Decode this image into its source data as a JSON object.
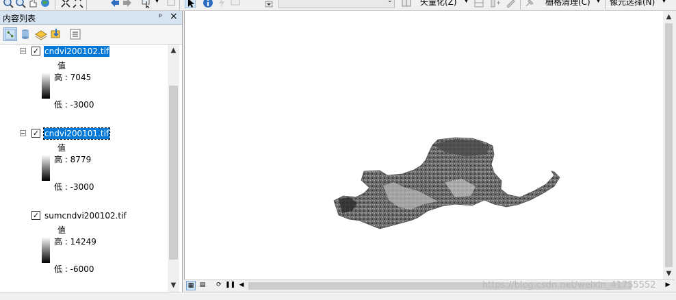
{
  "toolbar": {
    "vectorize_label": "矢量化(Z)",
    "raster_clean_label": "栅格清理(C)",
    "pixel_select_label": "像元选择(N)",
    "drop_arrow": "▼"
  },
  "toc": {
    "title": "内容列表",
    "pin_glyph": "ᵖ",
    "close_glyph": "×",
    "layers": [
      {
        "name": "cndvi200102.tif",
        "checked": "✓",
        "value_label": "值",
        "high": "高 : 7045",
        "low": "低 : -3000"
      },
      {
        "name": "cndvi200101.tif",
        "checked": "✓",
        "value_label": "值",
        "high": "高 : 8779",
        "low": "低 : -3000"
      },
      {
        "name": "sumcndvi200102.tif",
        "checked": "✓",
        "value_label": "值",
        "high": "高 : 14249",
        "low": "低 : -6000"
      }
    ]
  },
  "scroll": {
    "up": "▲",
    "down": "▼",
    "left": "◀",
    "right": "▶"
  },
  "watermark": "https://blog.csdn.net/weixin_41755552",
  "colors": {
    "selection": "#0078d7",
    "panel_header": "#d6e4f2"
  }
}
